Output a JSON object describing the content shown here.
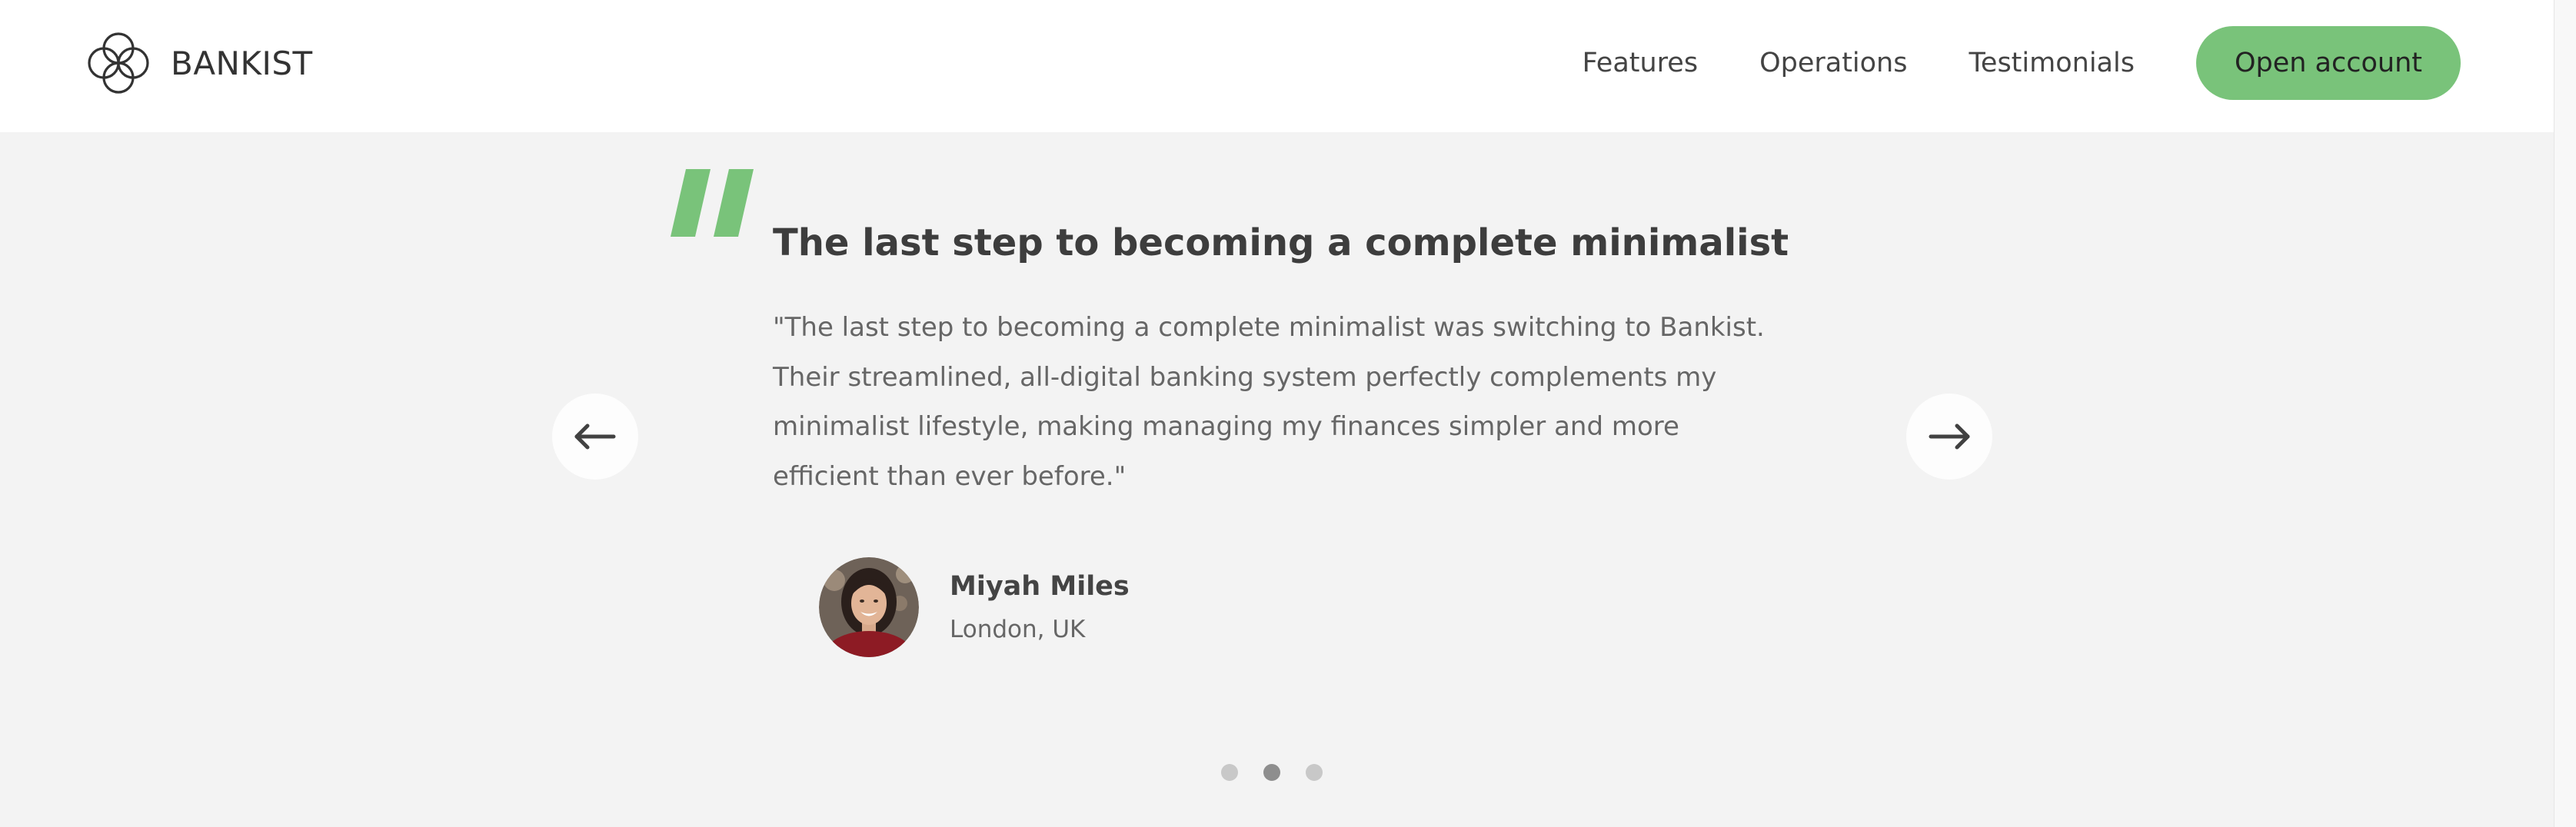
{
  "brand": {
    "name": "BANKIST"
  },
  "nav": {
    "links": [
      "Features",
      "Operations",
      "Testimonials"
    ],
    "cta_label": "Open account"
  },
  "testimonial": {
    "heading": "The last step to becoming a complete minimalist",
    "text": "\"The last step to becoming a complete minimalist was switching to Bankist.\nTheir streamlined, all-digital banking system perfectly complements my\nminimalist lifestyle, making managing my finances simpler and more\nefficient than ever before.\"",
    "author_name": "Miyah Miles",
    "author_location": "London, UK"
  },
  "slider": {
    "dot_count": 3,
    "active_dot": 1
  },
  "icons": {
    "logo": "logo-icon",
    "quote": "quote-icon",
    "prev": "arrow-left-icon",
    "next": "arrow-right-icon"
  },
  "colors": {
    "accent": "#79c37a",
    "header_bg": "#ffffff",
    "section_bg": "#f3f3f3",
    "dot": "#c8c8c8",
    "dot_active": "#8e8e8e"
  }
}
